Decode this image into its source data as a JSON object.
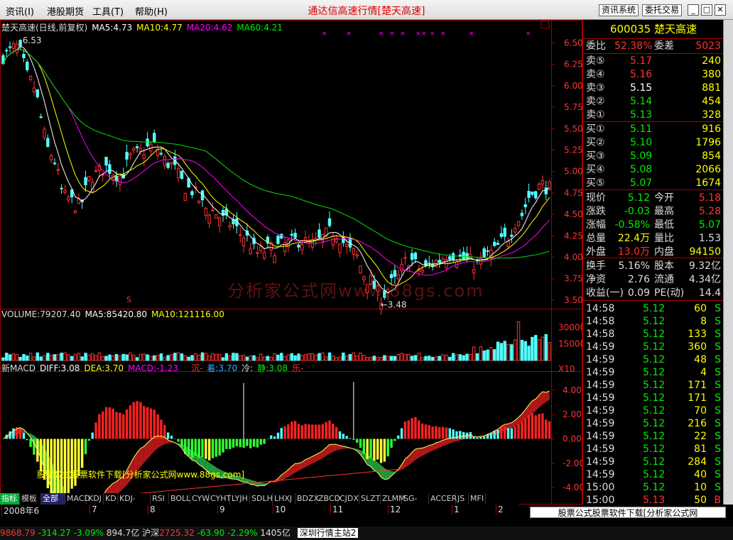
{
  "menubar": {
    "items": [
      "资讯(I)",
      "港股期货",
      "工具(T)",
      "帮助(H)"
    ],
    "title": "通达信高速行情[楚天高速]",
    "buttons": [
      "资讯系统",
      "委托交易"
    ]
  },
  "main_legend": {
    "name": "楚天高速(日线,前复权)",
    "ma5": "MA5:4.73",
    "ma10": "MA10:4.77",
    "ma20": "MA20:4.62",
    "ma60": "MA60:4.21"
  },
  "volume_legend": {
    "vol": "VOLUME:79207.40",
    "ma5": "MA5:85420.80",
    "ma10": "MA10:121116.00"
  },
  "macd_legend": {
    "name": "新MACD",
    "diff": "DIFF:3.08",
    "dea": "DEA:3.70",
    "macd": "MACD:-1.23",
    "c1": "沉-",
    "c2": "着:3.70",
    "c3": "冷:",
    "c4": "静:3.08",
    "c5": "乐-"
  },
  "price_labels": {
    "high": "6.53",
    "low": "←3.48",
    "marker": "S"
  },
  "price_axis": [
    "6.50",
    "6.25",
    "6.00",
    "5.75",
    "5.50",
    "5.25",
    "5.00",
    "4.75",
    "4.50",
    "4.25",
    "4.00",
    "3.75",
    "3.50"
  ],
  "volume_axis": [
    "30000",
    "15000",
    "X10"
  ],
  "macd_axis": [
    "4.00",
    "2.00",
    "0.00",
    "-2.00",
    "-4.00"
  ],
  "date_axis": [
    "2008年6",
    "7",
    "8",
    "9",
    "10",
    "11",
    "12",
    "1",
    "2"
  ],
  "tabs": [
    "指标",
    "模板",
    "全部",
    "MACD",
    "KDJ",
    "KD",
    "KDJ-TDX",
    "RSI",
    "BOLL",
    "CYW",
    "CYHT",
    "LYJH",
    "SDLH",
    "LHXJ",
    "BDZX",
    "ZBCD",
    "CJDX",
    "SLZT",
    "ZLMM",
    "SG-LB",
    "ACCER",
    "JS",
    "MFI"
  ],
  "right_panel": {
    "code": "600035",
    "name": "楚天高速",
    "weibi_label": "委比",
    "weibi": "52.38%",
    "weicha_label": "委差",
    "weicha": "5023",
    "asks": [
      {
        "label": "卖⑤",
        "price": "5.17",
        "vol": "240"
      },
      {
        "label": "卖④",
        "price": "5.16",
        "vol": "380"
      },
      {
        "label": "卖③",
        "price": "5.15",
        "vol": "881"
      },
      {
        "label": "卖②",
        "price": "5.14",
        "vol": "454"
      },
      {
        "label": "卖①",
        "price": "5.13",
        "vol": "328"
      }
    ],
    "bids": [
      {
        "label": "买①",
        "price": "5.11",
        "vol": "916"
      },
      {
        "label": "买②",
        "price": "5.10",
        "vol": "1796"
      },
      {
        "label": "买③",
        "price": "5.09",
        "vol": "854"
      },
      {
        "label": "买④",
        "price": "5.08",
        "vol": "2066"
      },
      {
        "label": "买⑤",
        "price": "5.07",
        "vol": "1674"
      }
    ],
    "stats": [
      {
        "l1": "现价",
        "v1": "5.12",
        "l2": "今开",
        "v2": "5.18"
      },
      {
        "l1": "涨跌",
        "v1": "-0.03",
        "l2": "最高",
        "v2": "5.28"
      },
      {
        "l1": "涨幅",
        "v1": "-0.58%",
        "l2": "最低",
        "v2": "5.07"
      },
      {
        "l1": "总量",
        "v1": "22.4万",
        "l2": "量比",
        "v2": "1.53"
      },
      {
        "l1": "外盘",
        "v1": "13.0万",
        "l2": "内盘",
        "v2": "94150"
      }
    ],
    "stats2": [
      {
        "l1": "换手",
        "v1": "5.16%",
        "l2": "股本",
        "v2": "9.32亿"
      },
      {
        "l1": "净资",
        "v1": "2.76",
        "l2": "流通",
        "v2": "4.34亿"
      },
      {
        "l1": "收益(一)",
        "v1": "0.09",
        "l2": "PE(动)",
        "v2": "14.4"
      }
    ],
    "ticks": [
      {
        "t": "14:58",
        "p": "5.12",
        "v": "60",
        "s": "S"
      },
      {
        "t": "14:58",
        "p": "5.12",
        "v": "8",
        "s": "S"
      },
      {
        "t": "14:58",
        "p": "5.12",
        "v": "133",
        "s": "S"
      },
      {
        "t": "14:59",
        "p": "5.12",
        "v": "360",
        "s": "S"
      },
      {
        "t": "14:59",
        "p": "5.12",
        "v": "48",
        "s": "S"
      },
      {
        "t": "14:59",
        "p": "5.12",
        "v": "4",
        "s": "S"
      },
      {
        "t": "14:59",
        "p": "5.12",
        "v": "171",
        "s": "S"
      },
      {
        "t": "14:59",
        "p": "5.12",
        "v": "171",
        "s": "S"
      },
      {
        "t": "14:59",
        "p": "5.12",
        "v": "70",
        "s": "S"
      },
      {
        "t": "14:59",
        "p": "5.12",
        "v": "216",
        "s": "S"
      },
      {
        "t": "14:59",
        "p": "5.12",
        "v": "22",
        "s": "S"
      },
      {
        "t": "14:59",
        "p": "5.12",
        "v": "81",
        "s": "S"
      },
      {
        "t": "14:59",
        "p": "5.12",
        "v": "284",
        "s": "S"
      },
      {
        "t": "14:59",
        "p": "5.12",
        "v": "40",
        "s": "S"
      },
      {
        "t": "15:00",
        "p": "5.12",
        "v": "10",
        "s": "S"
      },
      {
        "t": "15:00",
        "p": "5.13",
        "v": "50",
        "s": "B"
      }
    ]
  },
  "watermarks": {
    "bottom": "股票公式股票软件下载[分析家公式网www.88gs.com]",
    "macd": "股票公式股票软件下载[分析家公式网www.88gs.com]",
    "center": "分析家公式网www.88gs.com"
  },
  "status": {
    "sh": "9868.79",
    "sh_chg": "-314.27",
    "sh_pct": "-3.09%",
    "sh_amt": "894.7亿",
    "sz_label": "沪深",
    "sz": "2725.32",
    "sz_chg": "-63.90",
    "sz_pct": "-2.29%",
    "sz_amt": "1405亿",
    "server": "深圳行情主站2"
  },
  "chart_data": {
    "type": "candlestick",
    "ylim": [
      3.4,
      6.62
    ],
    "x": {
      "start": "2008-06-24",
      "end": "2009-02-27",
      "unit": "trading day",
      "count": 160
    },
    "month_ticks": [
      "2008年6",
      "7",
      "8",
      "9",
      "10",
      "11",
      "12",
      "1",
      "2"
    ],
    "series": [
      {
        "name": "MA5",
        "last": 4.73
      },
      {
        "name": "MA10",
        "last": 4.77
      },
      {
        "name": "MA20",
        "last": 4.62
      },
      {
        "name": "MA60",
        "last": 4.21
      }
    ],
    "high": 6.53,
    "low": 3.48,
    "volume": {
      "ylim": [
        0,
        36000
      ],
      "ticks": [
        30000,
        15000
      ],
      "last": 79207.4,
      "ma5": 85420.8,
      "ma10": 121116.0
    },
    "macd": {
      "ylim": [
        -5.4,
        5.4
      ],
      "ticks": [
        4,
        2,
        0,
        -2,
        -4
      ],
      "diff": 3.08,
      "dea": 3.7,
      "macd": -1.23
    },
    "colors": {
      "up": "#ff3232",
      "down": "#54ffff",
      "ma5": "#ffffff",
      "ma10": "#ffff00",
      "ma20": "#ff00ff",
      "ma60": "#00e000",
      "grid": "#a00000"
    }
  }
}
